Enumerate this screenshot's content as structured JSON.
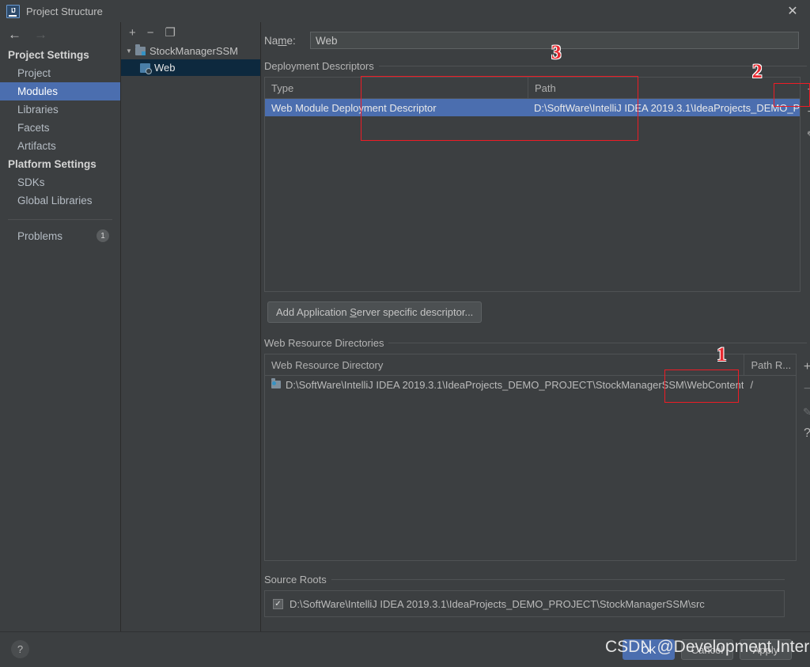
{
  "window": {
    "title": "Project Structure",
    "app_icon": "intellij-idea-icon",
    "close_label": "✕"
  },
  "sidebar": {
    "back_icon": "←",
    "forward_icon": "→",
    "groups": [
      {
        "label": "Project Settings"
      },
      {
        "label": "Platform Settings"
      }
    ],
    "project_settings_items": [
      {
        "label": "Project",
        "selected": false
      },
      {
        "label": "Modules",
        "selected": true
      },
      {
        "label": "Libraries",
        "selected": false
      },
      {
        "label": "Facets",
        "selected": false
      },
      {
        "label": "Artifacts",
        "selected": false
      }
    ],
    "platform_settings_items": [
      {
        "label": "SDKs",
        "selected": false
      },
      {
        "label": "Global Libraries",
        "selected": false
      }
    ],
    "problems": {
      "label": "Problems",
      "count": "1"
    }
  },
  "tree": {
    "toolbar": [
      {
        "name": "add-module-button",
        "glyph": "+"
      },
      {
        "name": "remove-module-button",
        "glyph": "−"
      },
      {
        "name": "copy-module-button",
        "glyph": "❐"
      }
    ],
    "nodes": [
      {
        "label": "StockManagerSSM",
        "expander": "▼",
        "icon": "module-icon",
        "selected": false
      },
      {
        "label": "Web",
        "expander": "",
        "icon": "web-facet-icon",
        "selected": true
      }
    ]
  },
  "main": {
    "name_field": {
      "label_prefix": "Na",
      "label_mnemonic": "m",
      "label_suffix": "e:",
      "value": "Web",
      "placeholder": "Web"
    },
    "deployment_descriptors": {
      "title": "Deployment Descriptors",
      "columns": [
        "Type",
        "Path"
      ],
      "rows": [
        {
          "type": "Web Module Deployment Descriptor",
          "path": "D:\\SoftWare\\IntelliJ IDEA 2019.3.1\\IdeaProjects_DEMO_P",
          "selected": true
        }
      ],
      "toolbar": [
        {
          "name": "add-descriptor-button",
          "glyph": "+"
        },
        {
          "name": "remove-descriptor-button",
          "glyph": "−"
        },
        {
          "name": "edit-descriptor-button",
          "glyph": "✎"
        }
      ]
    },
    "add_server_descriptor_button": {
      "prefix": "Add Application ",
      "mnemonic": "S",
      "suffix": "erver specific descriptor..."
    },
    "web_resource_directories": {
      "title": "Web Resource Directories",
      "columns": [
        "Web Resource Directory",
        "Path R..."
      ],
      "rows": [
        {
          "directory": "D:\\SoftWare\\IntelliJ IDEA 2019.3.1\\IdeaProjects_DEMO_PROJECT\\StockManagerSSM\\WebContent",
          "path_relative": "/",
          "icon": "folder-web-icon"
        }
      ],
      "toolbar": [
        {
          "name": "add-web-resource-button",
          "glyph": "+"
        },
        {
          "name": "remove-web-resource-button",
          "glyph": "−"
        },
        {
          "name": "edit-web-resource-button",
          "glyph": "✎"
        },
        {
          "name": "help-web-resource-button",
          "glyph": "?"
        }
      ]
    },
    "source_roots": {
      "title": "Source Roots",
      "rows": [
        {
          "checked": true,
          "check_glyph": "✓",
          "path": "D:\\SoftWare\\IntelliJ IDEA 2019.3.1\\IdeaProjects_DEMO_PROJECT\\StockManagerSSM\\src"
        }
      ]
    }
  },
  "footer": {
    "help_glyph": "?",
    "ok_label": "OK",
    "cancel_label": "Cancel",
    "apply_label": "Apply"
  },
  "annotations": {
    "numbers": [
      {
        "label": "1"
      },
      {
        "label": "2"
      },
      {
        "label": "3"
      }
    ],
    "color": "#ee1c25"
  },
  "watermark": {
    "text": "CSDN @Development Intern"
  }
}
